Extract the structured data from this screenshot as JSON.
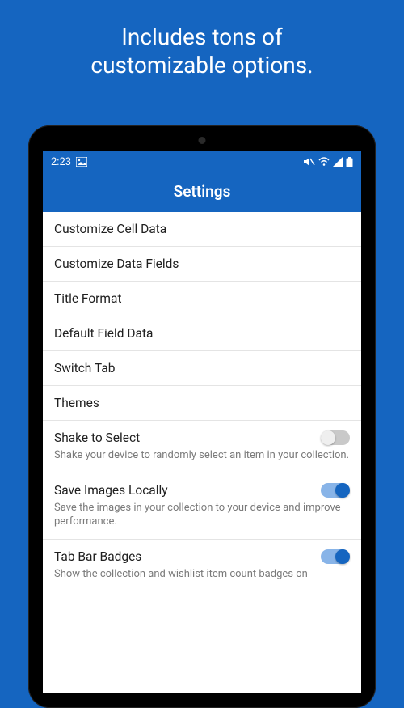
{
  "promo": {
    "line1": "Includes tons of",
    "line2": "customizable options."
  },
  "statusbar": {
    "time": "2:23"
  },
  "appbar": {
    "title": "Settings"
  },
  "rows": {
    "r0": "Customize Cell Data",
    "r1": "Customize Data Fields",
    "r2": "Title Format",
    "r3": "Default Field Data",
    "r4": "Switch Tab",
    "r5": "Themes"
  },
  "toggles": {
    "t0": {
      "title": "Shake to Select",
      "sub": "Shake your device to randomly select an item in your collection.",
      "on": false
    },
    "t1": {
      "title": "Save Images Locally",
      "sub": "Save the images in your collection to your device and improve performance.",
      "on": true
    },
    "t2": {
      "title": "Tab Bar Badges",
      "sub": "Show the collection and wishlist item count badges on",
      "on": true
    }
  }
}
